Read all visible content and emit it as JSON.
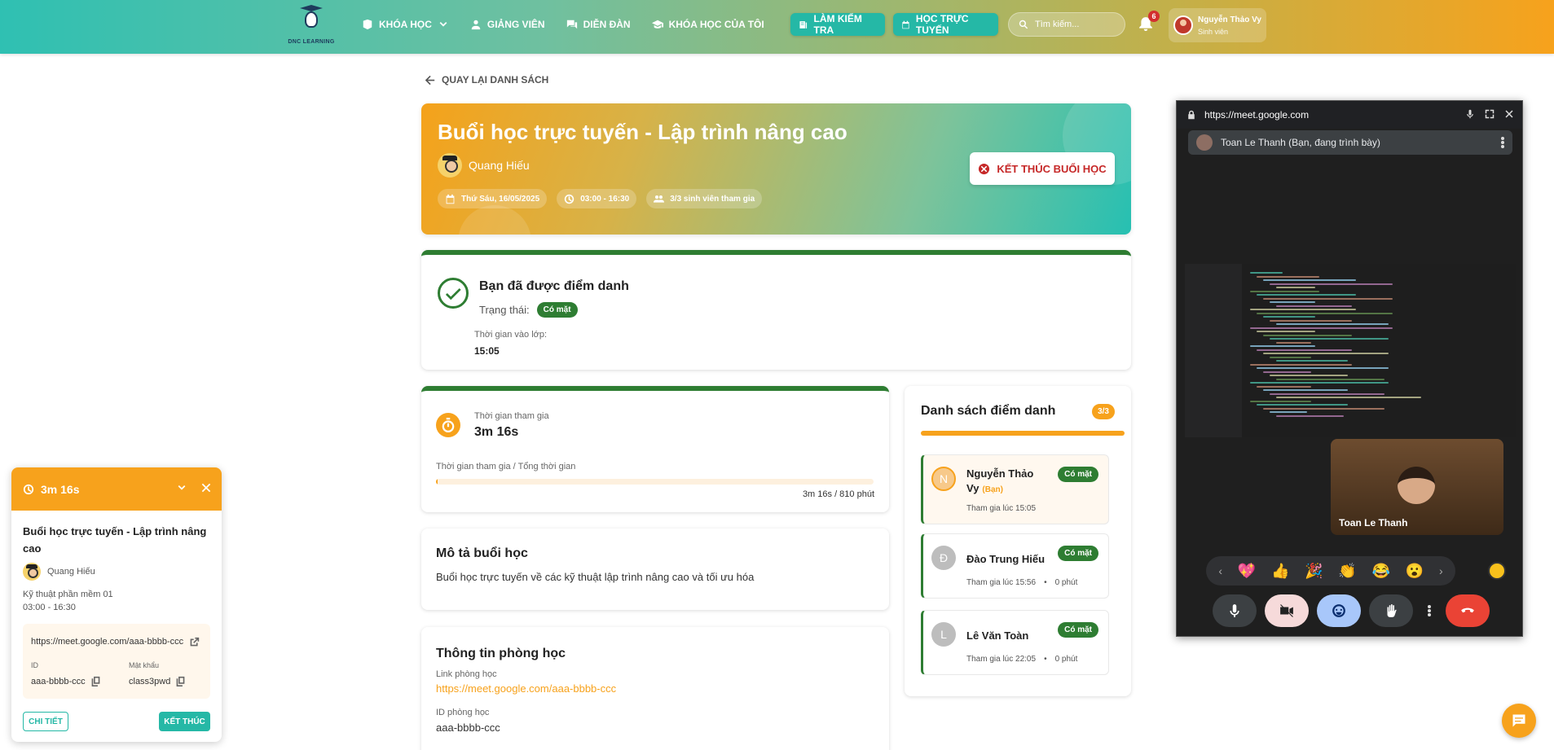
{
  "header": {
    "logo_text": "DNC LEARNING",
    "nav": [
      "KHÓA HỌC",
      "GIẢNG VIÊN",
      "DIỄN ĐÀN",
      "KHÓA HỌC CỦA TÔI"
    ],
    "test_button": "LÀM KIỂM TRA",
    "online_button": "HỌC TRỰC TUYẾN",
    "search_placeholder": "Tìm kiếm...",
    "notification_count": "6",
    "user_name": "Nguyễn Thảo Vy",
    "user_role": "Sinh viên"
  },
  "back_label": "QUAY LẠI DANH SÁCH",
  "hero": {
    "title": "Buổi học trực tuyến - Lập trình nâng cao",
    "teacher": "Quang Hiếu",
    "date": "Thứ Sáu, 16/05/2025",
    "time": "03:00 - 16:30",
    "participants": "3/3 sinh viên tham gia",
    "end_button": "KẾT THÚC BUỔI HỌC"
  },
  "attendance": {
    "title": "Bạn đã được điểm danh",
    "status_label": "Trạng thái:",
    "status_badge": "Có mặt",
    "entry_label": "Thời gian vào lớp:",
    "entry_time": "15:05"
  },
  "duration": {
    "label": "Thời gian tham gia",
    "value": "3m 16s",
    "ratio_label": "Thời gian tham gia / Tổng thời gian",
    "ratio_value": "3m 16s / 810 phút",
    "progress_percent": 0.4
  },
  "description": {
    "title": "Mô tả buổi học",
    "text": "Buổi học trực tuyến về các kỹ thuật lập trình nâng cao và tối ưu hóa"
  },
  "room": {
    "title": "Thông tin phòng học",
    "link_label": "Link phòng học",
    "link": "https://meet.google.com/aaa-bbbb-ccc",
    "id_label": "ID phòng học",
    "id": "aaa-bbbb-ccc"
  },
  "roster": {
    "title": "Danh sách điểm danh",
    "count": "3/3",
    "items": [
      {
        "initial": "N",
        "name": "Nguyễn Thảo Vy",
        "tag": "(Bạn)",
        "badge": "Có mặt",
        "joined": "Tham gia lúc 15:05",
        "duration": ""
      },
      {
        "initial": "Đ",
        "name": "Đào Trung Hiếu",
        "tag": "",
        "badge": "Có mặt",
        "joined": "Tham gia lúc 15:56",
        "duration": "0 phút"
      },
      {
        "initial": "L",
        "name": "Lê Văn Toàn",
        "tag": "",
        "badge": "Có mặt",
        "joined": "Tham gia lúc 22:05",
        "duration": "0 phút"
      }
    ]
  },
  "meet": {
    "url": "https://meet.google.com",
    "presenter": "Toan Le Thanh (Bạn, đang trình bày)",
    "pip_name": "Toan Le Thanh",
    "reactions": [
      "💖",
      "👍",
      "🎉",
      "👏",
      "😂",
      "😮"
    ]
  },
  "mini": {
    "timer": "3m 16s",
    "title": "Buổi học trực tuyến - Lập trình nâng cao",
    "teacher": "Quang Hiếu",
    "course": "Kỹ thuật phần mềm 01",
    "time": "03:00 - 16:30",
    "link": "https://meet.google.com/aaa-bbbb-ccc",
    "id_label": "ID",
    "id": "aaa-bbbb-ccc",
    "pw_label": "Mật khẩu",
    "pw": "class3pwd",
    "detail_button": "CHI TIẾT",
    "end_button": "KẾT THÚC"
  },
  "colors": {
    "accent": "#f7a21c",
    "teal": "#25b8a6",
    "green": "#2e7d32",
    "danger": "#c62828"
  }
}
